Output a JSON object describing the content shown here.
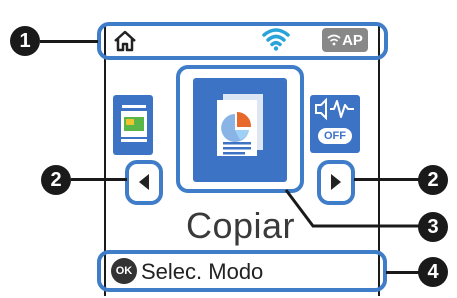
{
  "status_bar": {
    "icons": [
      "home-icon",
      "wifi-icon",
      "wifi-ap-icon"
    ],
    "ap_label": "AP"
  },
  "modes": {
    "previous_icon": "scanner-icon",
    "selected_icon": "copy-document-icon",
    "next_icon": "eco-mode-icon",
    "next_badge": "OFF"
  },
  "selected_mode_label": "Copiar",
  "footer": {
    "ok_label": "OK",
    "hint": "Selec. Modo"
  },
  "callouts": [
    "1",
    "2",
    "2",
    "3",
    "4"
  ],
  "colors": {
    "highlight": "#3f7dc8",
    "tile": "#3d73c4",
    "wifi": "#2aa3d8"
  }
}
